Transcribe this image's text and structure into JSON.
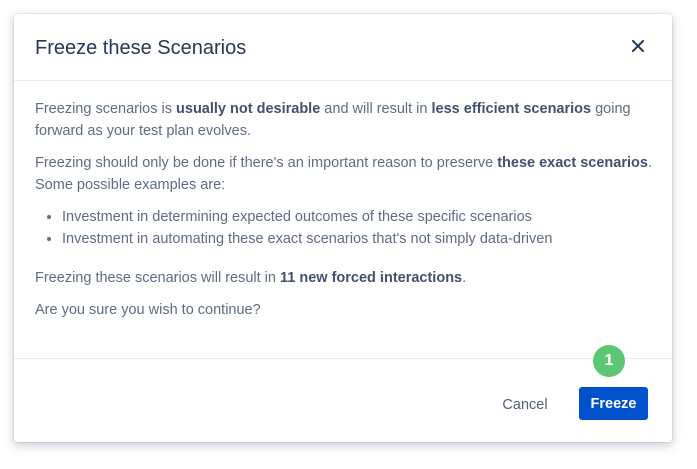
{
  "dialog": {
    "title": "Freeze these Scenarios",
    "close_icon": "close-icon",
    "body": {
      "p1": {
        "t1": "Freezing scenarios is ",
        "b1": "usually not desirable",
        "t2": " and will result in ",
        "b2": "less efficient scenarios",
        "t3": " going forward as your test plan evolves."
      },
      "p2": {
        "t1": "Freezing should only be done if there's an important reason to preserve ",
        "b1": "these exact scenarios",
        "t2": ". Some possible examples are:"
      },
      "bullets": [
        "Investment in determining expected outcomes of these specific scenarios",
        "Investment in automating these exact scenarios that's not simply data-driven"
      ],
      "p3": {
        "t1": "Freezing these scenarios will result in ",
        "b1": "11 new forced interactions",
        "t2": "."
      },
      "p4": "Are you sure you wish to continue?"
    },
    "footer": {
      "cancel_label": "Cancel",
      "freeze_label": "Freeze"
    },
    "step_badge": "1"
  },
  "colors": {
    "primary_button": "#0052cc",
    "step_badge": "#5cc774",
    "title_text": "#253858",
    "body_text": "#5e6c84"
  }
}
